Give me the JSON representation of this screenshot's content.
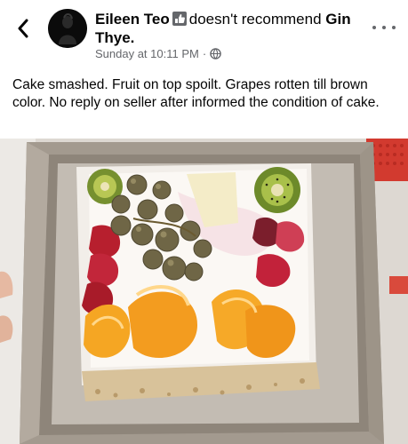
{
  "post": {
    "author": "Eileen Teo",
    "verb": "doesn't recommend",
    "business": "Gin Thye.",
    "timestamp": "Sunday at 10:11 PM",
    "separator": "·",
    "text": "Cake smashed. Fruit on top spoilt. Grapes rotten till brown color. No reply on seller after informed the condition of cake."
  },
  "icons": {
    "back": "chevron-left-icon",
    "badge": "recommend-badge-icon",
    "privacy": "globe-icon",
    "more": "more-dots-icon"
  },
  "colors": {
    "text": "#050505",
    "secondary": "#65676b",
    "background": "#ffffff"
  }
}
